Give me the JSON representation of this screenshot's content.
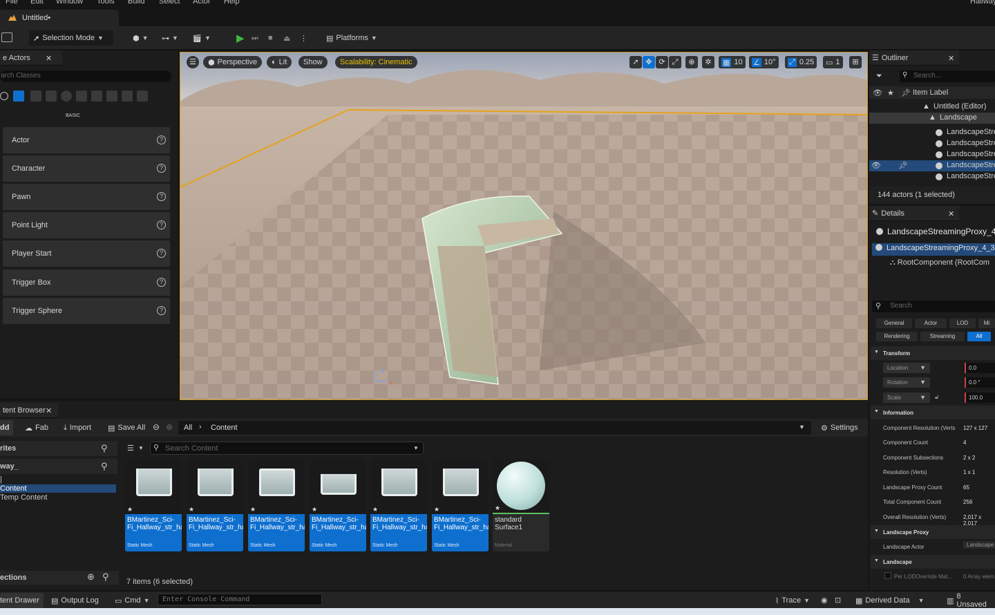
{
  "menu": [
    "File",
    "Edit",
    "Window",
    "Tools",
    "Build",
    "Select",
    "Actor",
    "Help"
  ],
  "project_name": "Hallway",
  "doc_tab": "Untitled•",
  "toolbar": {
    "selection_mode": "Selection Mode",
    "platforms": "Platforms"
  },
  "place_actors": {
    "tab": "e Actors",
    "search_placeholder": "arch Classes",
    "category": "BASIC",
    "items": [
      "Actor",
      "Character",
      "Pawn",
      "Point Light",
      "Player Start",
      "Trigger Box",
      "Trigger Sphere"
    ]
  },
  "viewport": {
    "perspective": "Perspective",
    "lit": "Lit",
    "show": "Show",
    "scalability": "Scalability: Cinematic",
    "grid_snap": "10",
    "rot_snap": "10°",
    "scale_snap": "0.25",
    "camera_speed": "1",
    "colors": {
      "selection": "#d29a1c",
      "scalability": "#e6c200"
    }
  },
  "outliner": {
    "tab": "Outliner",
    "search_placeholder": "Search...",
    "column": "Item Label",
    "rows": [
      "Untitled (Editor)",
      "Landscape",
      "LandscapeStre",
      "LandscapeStre",
      "LandscapeStre",
      "LandscapeStre",
      "LandscapeStre"
    ],
    "count": "144 actors (1 selected)"
  },
  "details": {
    "tab": "Details",
    "object": "LandscapeStreamingProxy_4_",
    "component_row": "LandscapeStreamingProxy_4_3",
    "root": "RootComponent (RootCom",
    "search_placeholder": "Search",
    "filters_row1": [
      "General",
      "Actor",
      "LOD",
      "Mi"
    ],
    "filters_row2": [
      "Rendering",
      "Streaming",
      "All"
    ],
    "transform_cat": "Transform",
    "transform": [
      {
        "label": "Location",
        "value": "0.0"
      },
      {
        "label": "Rotation",
        "value": "0.0 °"
      },
      {
        "label": "Scale",
        "value": "100.0"
      }
    ],
    "information_cat": "Information",
    "information": [
      {
        "k": "Component Resolution (Verts",
        "v": "127 x 127"
      },
      {
        "k": "Component Count",
        "v": "4"
      },
      {
        "k": "Component Subsections",
        "v": "2 x 2"
      },
      {
        "k": "Resolution (Verts)",
        "v": "1 x 1"
      },
      {
        "k": "Landscape Proxy Count",
        "v": "65"
      },
      {
        "k": "Total Component Count",
        "v": "256"
      },
      {
        "k": "Overall Resolution (Verts)",
        "v": "2,017 x 2,017"
      }
    ],
    "proxy_cat": "Landscape Proxy",
    "landscape_actor_k": "Landscape Actor",
    "landscape_actor_v": "Landscape",
    "landscape_cat": "Landscape",
    "lod_override_k": "Per LODOverride Mat...",
    "lod_override_v": "0 Array elem"
  },
  "content_browser": {
    "tab": "tent Browser",
    "add": "dd",
    "fab": "Fab",
    "import": "Import",
    "save_all": "Save All",
    "path_all": "All",
    "path_content": "Content",
    "settings": "Settings",
    "favorites": "rites",
    "tree_root": "way_",
    "tree_items": [
      "|",
      "Content",
      "Temp Content"
    ],
    "collections": "ections",
    "search_placeholder": "Search Content",
    "assets": [
      {
        "name": "BMartinez_Sci-Fi_Hallway_str_hallway_grp2_s...",
        "type": "Static Mesh"
      },
      {
        "name": "BMartinez_Sci-Fi_Hallway_str_hallway_grp3_s...",
        "type": "Static Mesh"
      },
      {
        "name": "BMartinez_Sci-Fi_Hallway_str_hallway_grp4_s...",
        "type": "Static Mesh"
      },
      {
        "name": "BMartinez_Sci-Fi_Hallway_str_hallway_grp5_s...",
        "type": "Static Mesh"
      },
      {
        "name": "BMartinez_Sci-Fi_Hallway_str_hallway_grp6_s...",
        "type": "Static Mesh"
      },
      {
        "name": "BMartinez_Sci-Fi_Hallway_str_hallway_grp_st...",
        "type": "Static Mesh"
      },
      {
        "name": "standard Surface1",
        "type": "Material"
      }
    ],
    "item_count": "7 items (6 selected)"
  },
  "statusbar": {
    "content_drawer": "tent Drawer",
    "output_log": "Output Log",
    "cmd": "Cmd",
    "console_placeholder": "Enter Console Command",
    "trace": "Trace",
    "derived_data": "Derived Data",
    "unsaved": "8 Unsaved"
  }
}
